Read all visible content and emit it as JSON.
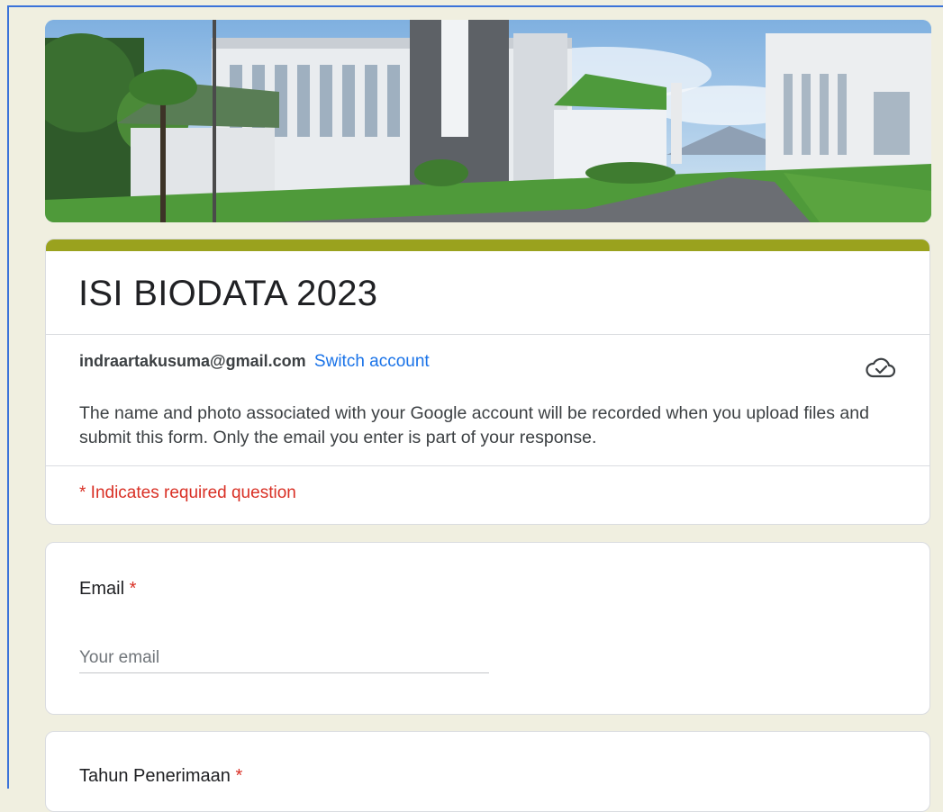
{
  "form": {
    "title": "ISI BIODATA 2023",
    "account_email": "indraartakusuma@gmail.com",
    "switch_account": "Switch account",
    "notice": "The name and photo associated with your Google account will be recorded when you upload files and submit this form. Only the email you enter is part of your response.",
    "required_note": "* Indicates required question"
  },
  "questions": [
    {
      "label": "Email",
      "required_mark": "*",
      "placeholder": "Your email"
    },
    {
      "label": "Tahun Penerimaan",
      "required_mark": "*"
    }
  ],
  "colors": {
    "accent": "#9aa21e",
    "link": "#1a73e8",
    "required": "#d93025",
    "background": "#f0efe0"
  },
  "icons": {
    "cloud": "cloud-check-icon"
  }
}
